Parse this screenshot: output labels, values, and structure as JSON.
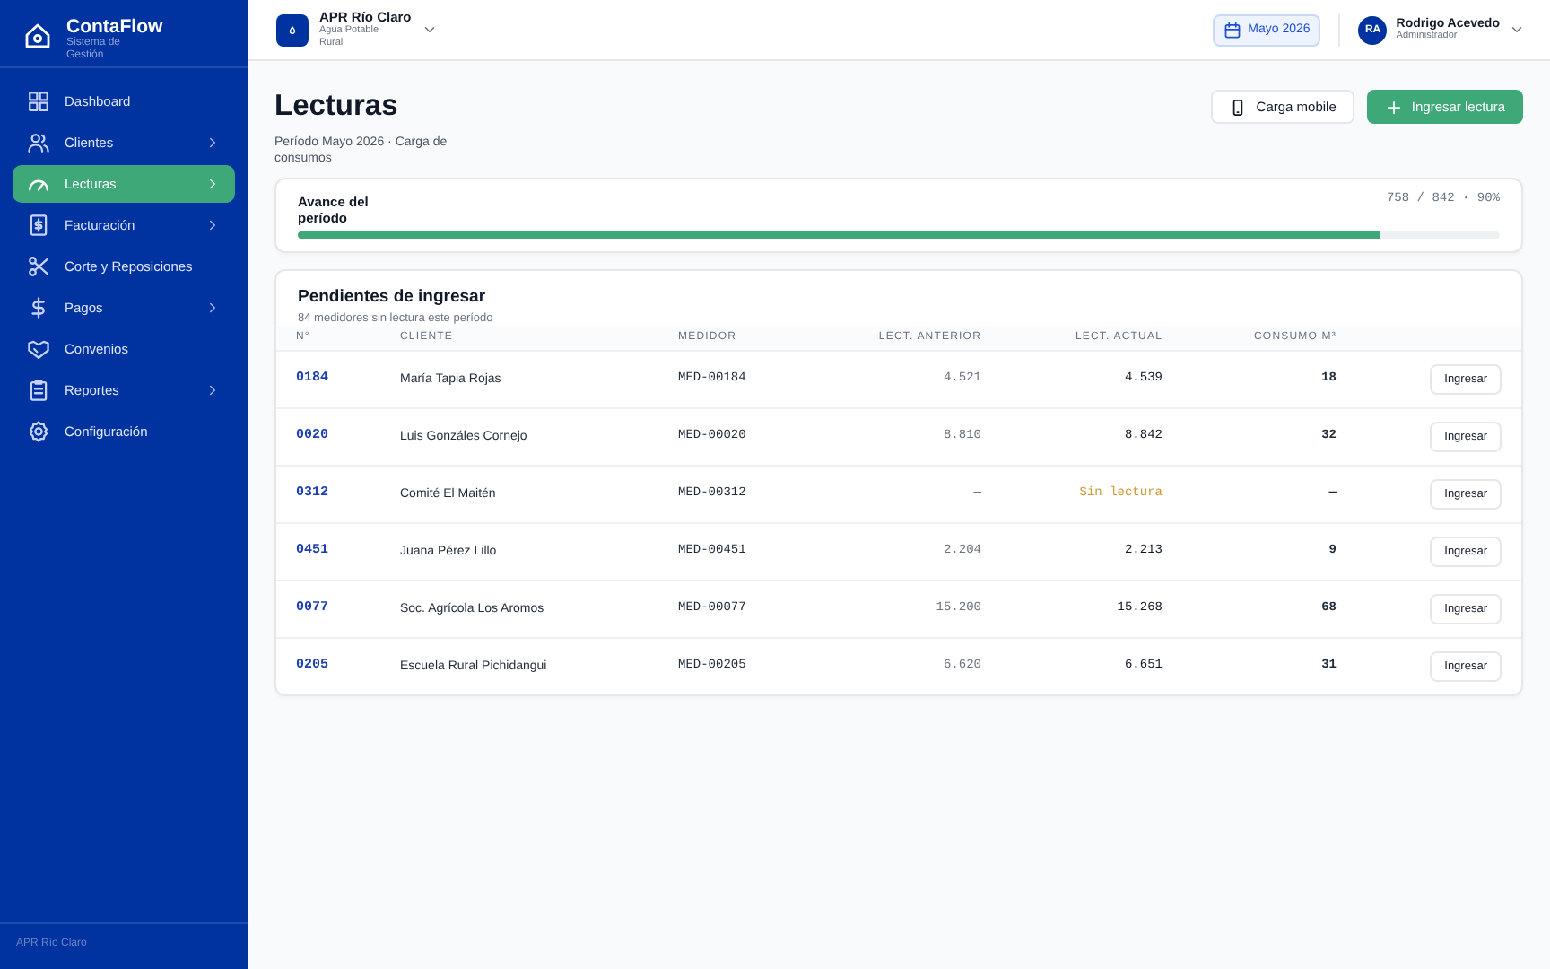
{
  "sidebar": {
    "brand": {
      "name": "ContaFlow",
      "subtitle": "Sistema de Gestión"
    },
    "items": [
      {
        "label": "Dashboard",
        "selected": false,
        "has_submenu": false
      },
      {
        "label": "Clientes",
        "selected": false,
        "has_submenu": true
      },
      {
        "label": "Lecturas",
        "selected": true,
        "has_submenu": true
      },
      {
        "label": "Facturación",
        "selected": false,
        "has_submenu": true
      },
      {
        "label": "Corte y Reposiciones",
        "selected": false,
        "has_submenu": false
      },
      {
        "label": "Pagos",
        "selected": false,
        "has_submenu": true
      },
      {
        "label": "Convenios",
        "selected": false,
        "has_submenu": false
      },
      {
        "label": "Reportes",
        "selected": false,
        "has_submenu": true
      },
      {
        "label": "Configuración",
        "selected": false,
        "has_submenu": false
      }
    ],
    "footer": "APR Río Claro"
  },
  "header": {
    "org": {
      "name": "APR Río Claro",
      "subtitle": "Agua Potable Rural"
    },
    "period": "Mayo 2026",
    "user": {
      "initials": "RA",
      "name": "Rodrigo Acevedo",
      "role": "Administrador"
    }
  },
  "page": {
    "title": "Lecturas",
    "subtitle": "Período Mayo 2026 · Carga de consumos",
    "buttons": [
      {
        "label": "Carga mobile",
        "kind": "secondary"
      },
      {
        "label": "Ingresar lectura",
        "kind": "primary"
      }
    ]
  },
  "progress": {
    "label": "Avance del período",
    "level": 0.9,
    "reading": "758 / 842 · 90%"
  },
  "table": {
    "title": "Pendientes de ingresar",
    "subtitle": "84 medidores sin lectura este período",
    "columns": [
      "N°",
      "CLIENTE",
      "MEDIDOR",
      "LECT. ANTERIOR",
      "LECT. ACTUAL",
      "CONSUMO M³"
    ],
    "rows": [
      {
        "number": "0184",
        "client": "María Tapia Rojas",
        "meter": "MED-00184",
        "previous": "4.521",
        "current": "4.539",
        "consumption": "18",
        "kind": "read",
        "action": "Ingresar"
      },
      {
        "number": "0020",
        "client": "Luis Gonzáles Cornejo",
        "meter": "MED-00020",
        "previous": "8.810",
        "current": "8.842",
        "consumption": "32",
        "kind": "read",
        "action": "Ingresar"
      },
      {
        "number": "0312",
        "client": "Comité El Maitén",
        "meter": "MED-00312",
        "previous": "—",
        "current": "Sin lectura",
        "consumption": "—",
        "kind": "missing",
        "action": "Ingresar"
      },
      {
        "number": "0451",
        "client": "Juana Pérez Lillo",
        "meter": "MED-00451",
        "previous": "2.204",
        "current": "2.213",
        "consumption": "9",
        "kind": "read",
        "action": "Ingresar"
      },
      {
        "number": "0077",
        "client": "Soc. Agrícola Los Aromos",
        "meter": "MED-00077",
        "previous": "15.200",
        "current": "15.268",
        "consumption": "68",
        "kind": "read",
        "action": "Ingresar"
      },
      {
        "number": "0205",
        "client": "Escuela Rural Pichidangui",
        "meter": "MED-00205",
        "previous": "6.620",
        "current": "6.651",
        "consumption": "31",
        "kind": "read",
        "action": "Ingresar"
      }
    ]
  }
}
